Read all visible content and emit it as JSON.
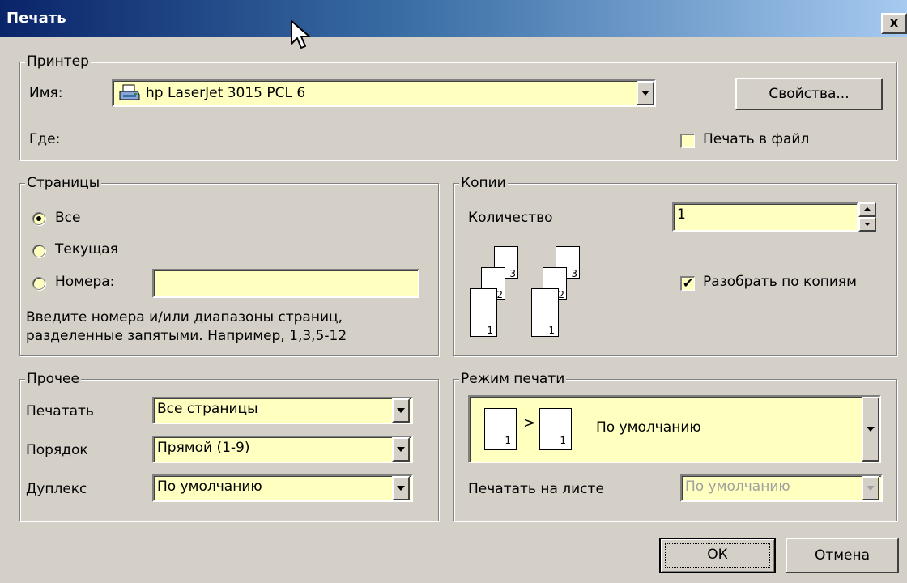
{
  "window": {
    "title": "Печать",
    "close_label": "x"
  },
  "printer": {
    "group_label": "Принтер",
    "name_label": "Имя:",
    "name_value": "hp LaserJet 3015 PCL 6",
    "where_label": "Где:",
    "properties_button": "Свойства...",
    "print_to_file_label": "Печать в файл",
    "print_to_file_checked": false
  },
  "pages": {
    "group_label": "Страницы",
    "options": [
      "Все",
      "Текущая",
      "Номера:"
    ],
    "selected": "Все",
    "numbers_value": "",
    "hint_line1": "Введите номера и/или диапазоны страниц,",
    "hint_line2": "разделенные запятыми. Например, 1,3,5-12"
  },
  "copies": {
    "group_label": "Копии",
    "count_label": "Количество",
    "count_value": "1",
    "collate_label": "Разобрать по копиям",
    "collate_checked": true,
    "collate_icon": {
      "page_numbers": [
        "3",
        "2",
        "1"
      ]
    }
  },
  "misc": {
    "group_label": "Прочее",
    "print_label": "Печатать",
    "print_value": "Все страницы",
    "order_label": "Порядок",
    "order_value": "Прямой (1-9)",
    "duplex_label": "Дуплекс",
    "duplex_value": "По умолчанию"
  },
  "print_mode": {
    "group_label": "Режим печати",
    "mode_value": "По умолчанию",
    "mode_icon": {
      "page_number": "1",
      "arrow": ">"
    },
    "per_sheet_label": "Печатать на листе",
    "per_sheet_value": "По умолчанию",
    "per_sheet_disabled": true
  },
  "buttons": {
    "ok": "ОК",
    "cancel": "Отмена"
  },
  "colors": {
    "titlebar_start": "#0a246a",
    "titlebar_end": "#a6caf0",
    "field_background": "#ffffc0",
    "dialog_background": "#d4d0c8"
  }
}
